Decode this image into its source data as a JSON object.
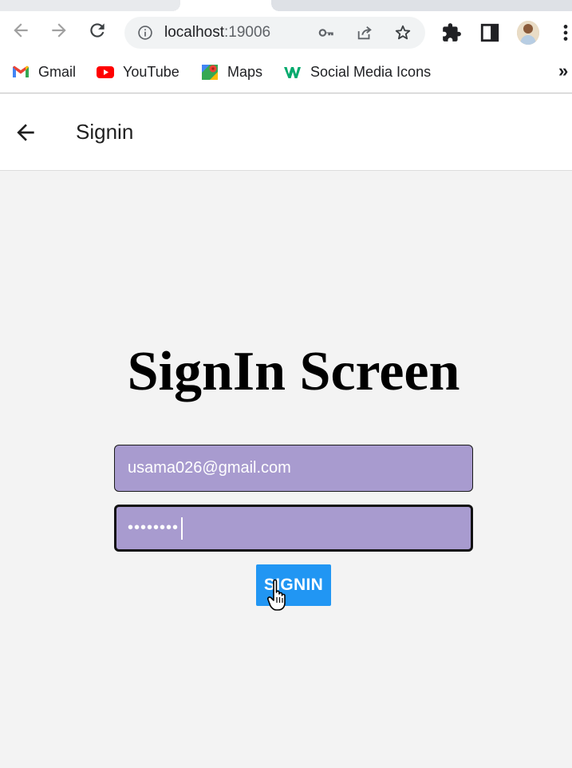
{
  "browser": {
    "url_host": "localhost",
    "url_port": ":19006",
    "bookmarks": [
      {
        "label": "Gmail",
        "icon": "gmail-icon"
      },
      {
        "label": "YouTube",
        "icon": "youtube-icon"
      },
      {
        "label": "Maps",
        "icon": "maps-icon"
      },
      {
        "label": "Social Media Icons",
        "icon": "w3-icon"
      }
    ],
    "more_bookmarks": "»"
  },
  "header": {
    "title": "Signin"
  },
  "main": {
    "screen_title": "SignIn Screen",
    "email_value": "usama026@gmail.com",
    "password_value": "••••••••",
    "signin_label": "SIGNIN"
  },
  "colors": {
    "field_bg": "#a89bcf",
    "button_bg": "#2196f3",
    "page_bg": "#f3f3f3"
  }
}
